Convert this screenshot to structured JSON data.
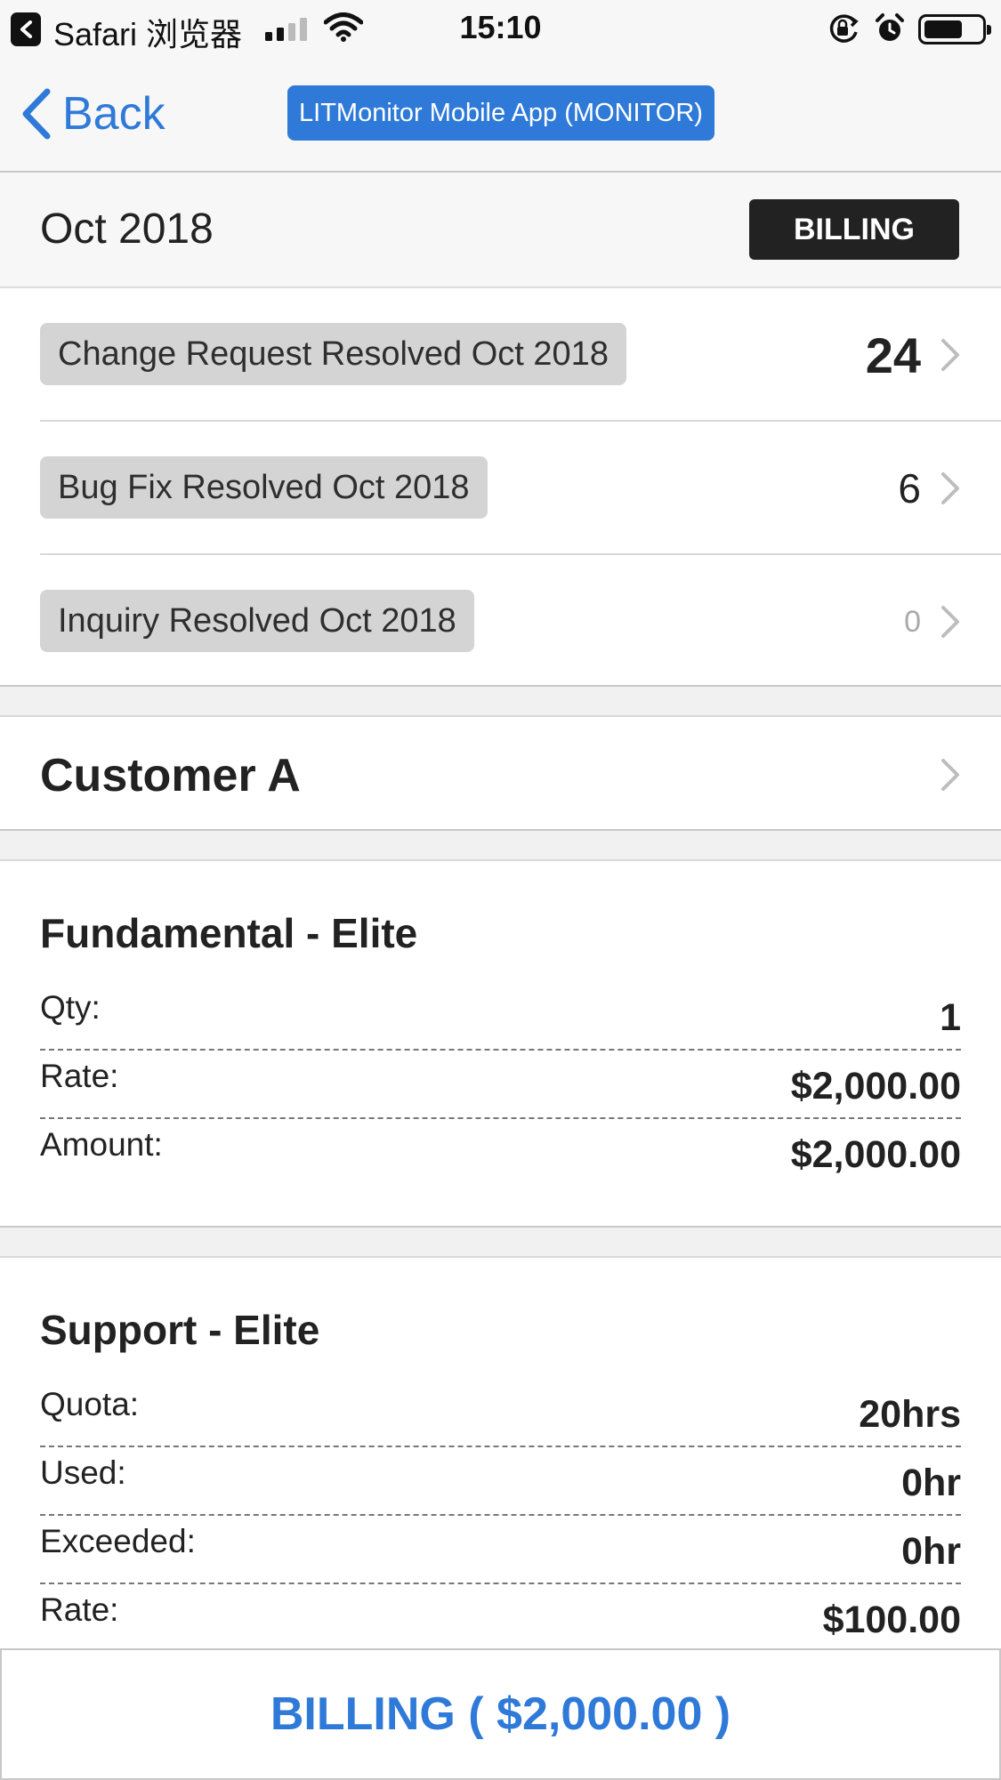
{
  "status_bar": {
    "app": "Safari 浏览器",
    "time": "15:10"
  },
  "nav": {
    "back_label": "Back",
    "app_title": "LITMonitor Mobile App (MONITOR)"
  },
  "period": {
    "label": "Oct 2018",
    "badge": "BILLING"
  },
  "resolved": [
    {
      "label": "Change Request Resolved Oct 2018",
      "count": "24"
    },
    {
      "label": "Bug Fix Resolved Oct 2018",
      "count": "6"
    },
    {
      "label": "Inquiry Resolved Oct 2018",
      "count": "0"
    }
  ],
  "customer": {
    "name": "Customer A"
  },
  "fundamental": {
    "title": "Fundamental - Elite",
    "rows": [
      {
        "key": "Qty:",
        "value": "1"
      },
      {
        "key": "Rate:",
        "value": "$2,000.00"
      },
      {
        "key": "Amount:",
        "value": "$2,000.00"
      }
    ]
  },
  "support": {
    "title": "Support - Elite",
    "rows": [
      {
        "key": "Quota:",
        "value": "20hrs"
      },
      {
        "key": "Used:",
        "value": "0hr"
      },
      {
        "key": "Exceeded:",
        "value": "0hr"
      },
      {
        "key": "Rate:",
        "value": "$100.00"
      }
    ]
  },
  "bottom": {
    "label": "BILLING ( $2,000.00 )"
  },
  "colors": {
    "accent": "#2f7ad8",
    "badge_dark": "#222222",
    "tag_gray": "#d4d4d4"
  },
  "icons": {
    "back": "chevron-left-icon",
    "row_chevron": "chevron-right-icon",
    "signal": "cellular-signal-icon",
    "wifi": "wifi-icon",
    "orientation_lock": "orientation-lock-icon",
    "alarm": "alarm-icon",
    "battery": "battery-icon"
  }
}
